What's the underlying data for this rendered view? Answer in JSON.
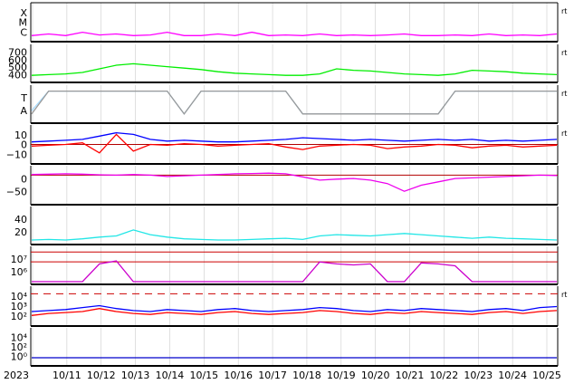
{
  "chart_data": {
    "type": "line",
    "title": "",
    "x_axis": {
      "ticks": [
        "2023",
        "10/11",
        "10/12",
        "10/13",
        "10/14",
        "10/15",
        "10/16",
        "10/17",
        "10/18",
        "10/19",
        "10/20",
        "10/21",
        "10/22",
        "10/23",
        "10/24",
        "10/25"
      ],
      "xlim": [
        "2023-10-10",
        "2023-10-25T14:00"
      ],
      "grid": true
    },
    "panels": [
      {
        "id": "class",
        "ylabels": [
          "X",
          "M",
          "C"
        ],
        "right_label": "rt",
        "series": [
          {
            "color": "#ff00ff",
            "values": [
              0.1,
              0.15,
              0.1,
              0.2,
              0.12,
              0.15,
              0.1,
              0.12,
              0.2,
              0.1,
              0.1,
              0.15,
              0.1,
              0.2,
              0.1,
              0.12,
              0.1,
              0.15,
              0.1,
              0.12,
              0.1,
              0.12,
              0.15,
              0.1,
              0.1,
              0.12,
              0.1,
              0.15,
              0.1,
              0.12,
              0.1,
              0.15
            ]
          }
        ]
      },
      {
        "id": "wind-speed",
        "ylabels": [
          "700",
          "600",
          "500",
          "400"
        ],
        "right_label": "rt",
        "ylim": [
          300,
          750
        ],
        "series": [
          {
            "color": "#00ee00",
            "values": [
              360,
              370,
              380,
              400,
              450,
              500,
              520,
              500,
              480,
              460,
              440,
              410,
              390,
              380,
              370,
              360,
              360,
              380,
              450,
              430,
              420,
              400,
              380,
              370,
              360,
              380,
              430,
              420,
              410,
              390,
              380,
              370
            ]
          }
        ]
      },
      {
        "id": "polarity",
        "ylabels": [
          "T",
          "A"
        ],
        "right_label": "rt",
        "series": [
          {
            "color": "#aaddff",
            "name": "",
            "values": [
              0.3,
              0.9,
              0.9,
              0.9,
              0.9,
              0.9,
              0.9,
              0.9,
              0.9,
              0.2,
              0.9,
              0.9,
              0.9,
              0.9,
              0.9,
              0.9,
              0.2,
              0.2,
              0.2,
              0.2,
              0.2,
              0.2,
              0.2,
              0.2,
              0.2,
              0.9,
              0.9,
              0.9,
              0.9,
              0.9,
              0.9,
              0.9
            ]
          },
          {
            "color": "#999999",
            "values": [
              0.2,
              0.9,
              0.9,
              0.9,
              0.9,
              0.9,
              0.9,
              0.9,
              0.9,
              0.2,
              0.9,
              0.9,
              0.9,
              0.9,
              0.9,
              0.9,
              0.2,
              0.2,
              0.2,
              0.2,
              0.2,
              0.2,
              0.2,
              0.2,
              0.2,
              0.9,
              0.9,
              0.9,
              0.9,
              0.9,
              0.9,
              0.9
            ]
          }
        ]
      },
      {
        "id": "bz",
        "ylabels": [
          "10",
          "0",
          "−10"
        ],
        "right_label": "rt",
        "ylim": [
          -20,
          20
        ],
        "zero_line": true,
        "series": [
          {
            "color": "#0000ff",
            "values": [
              3,
              4,
              5,
              6,
              10,
              14,
              12,
              6,
              4,
              5,
              4,
              3,
              3,
              4,
              5,
              6,
              8,
              7,
              6,
              5,
              6,
              5,
              4,
              5,
              6,
              5,
              6,
              4,
              5,
              4,
              5,
              6
            ]
          },
          {
            "color": "#ff0000",
            "values": [
              -2,
              -1,
              0,
              2,
              -10,
              12,
              -8,
              0,
              -1,
              1,
              0,
              -2,
              -1,
              0,
              1,
              -3,
              -6,
              -2,
              -1,
              0,
              -1,
              -5,
              -3,
              -2,
              0,
              -1,
              -4,
              -2,
              -1,
              -3,
              -2,
              -1
            ]
          }
        ]
      },
      {
        "id": "dst",
        "ylabels": [
          "0",
          "−50"
        ],
        "ylim": [
          -80,
          20
        ],
        "zero_line": true,
        "series": [
          {
            "color": "#ee00ee",
            "values": [
              2,
              3,
              4,
              3,
              1,
              0,
              2,
              0,
              -4,
              -2,
              0,
              2,
              4,
              5,
              6,
              4,
              -5,
              -15,
              -12,
              -10,
              -15,
              -25,
              -48,
              -30,
              -20,
              -10,
              -8,
              -6,
              -4,
              -2,
              0,
              -1
            ]
          }
        ]
      },
      {
        "id": "kp",
        "ylabels": [
          "40",
          "20"
        ],
        "ylim": [
          0,
          55
        ],
        "series": [
          {
            "color": "#22e6e6",
            "values": [
              3,
              4,
              3,
              5,
              8,
              10,
              20,
              12,
              8,
              5,
              4,
              3,
              3,
              4,
              5,
              6,
              4,
              10,
              12,
              11,
              10,
              12,
              14,
              12,
              10,
              8,
              6,
              8,
              6,
              5,
              4,
              3
            ]
          }
        ]
      },
      {
        "id": "proton",
        "ylabels": [
          "10⁷",
          "10⁶"
        ],
        "ylim": [
          4,
          7.3
        ],
        "log": true,
        "threshold_lines": [
          7,
          6
        ],
        "series": [
          {
            "color": "#cc00cc",
            "values": [
              4,
              4,
              4,
              4,
              5.8,
              6.1,
              4,
              4,
              4,
              4,
              4,
              4,
              4,
              4,
              4,
              4,
              4,
              6.0,
              5.8,
              5.7,
              5.8,
              4,
              4,
              5.9,
              5.8,
              5.6,
              4,
              4,
              4,
              4,
              4,
              4
            ]
          }
        ]
      },
      {
        "id": "xray",
        "ylabels": [
          "10⁴",
          "10³",
          "10²"
        ],
        "right_label": "rt",
        "ylim": [
          1,
          4.5
        ],
        "log": true,
        "threshold_lines": [
          4
        ],
        "series": [
          {
            "color": "#0000ff",
            "values": [
              2.2,
              2.3,
              2.4,
              2.6,
              2.8,
              2.5,
              2.3,
              2.2,
              2.4,
              2.3,
              2.2,
              2.4,
              2.5,
              2.3,
              2.2,
              2.3,
              2.4,
              2.6,
              2.5,
              2.3,
              2.2,
              2.4,
              2.3,
              2.5,
              2.4,
              2.3,
              2.2,
              2.4,
              2.5,
              2.3,
              2.6,
              2.7
            ]
          },
          {
            "color": "#ff0000",
            "values": [
              1.8,
              2.0,
              2.1,
              2.2,
              2.5,
              2.2,
              2.0,
              1.9,
              2.1,
              2.0,
              1.9,
              2.1,
              2.2,
              2.0,
              1.9,
              2.0,
              2.1,
              2.3,
              2.2,
              2.0,
              1.9,
              2.1,
              2.0,
              2.2,
              2.1,
              2.0,
              1.9,
              2.1,
              2.2,
              2.0,
              2.2,
              2.3
            ]
          }
        ]
      },
      {
        "id": "electron",
        "ylabels": [
          "10⁴",
          "10²",
          "10⁰"
        ],
        "ylim": [
          -1,
          5
        ],
        "log": true,
        "series": [
          {
            "color": "#0000cc",
            "values": [
              0,
              0,
              0,
              0,
              0,
              0,
              0,
              0,
              0,
              0,
              0,
              0,
              0,
              0,
              0,
              0,
              0,
              0,
              0,
              0,
              0,
              0,
              0,
              0,
              0,
              0,
              0,
              0,
              0,
              0,
              0,
              0
            ]
          }
        ]
      }
    ]
  }
}
